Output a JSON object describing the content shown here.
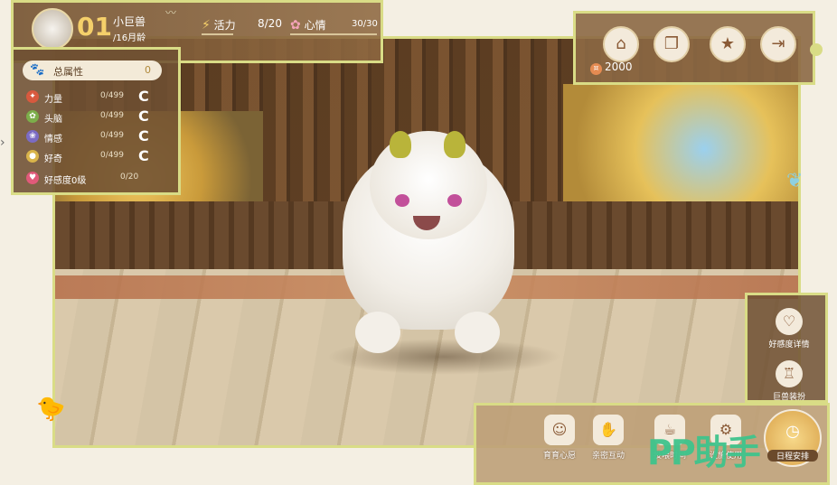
{
  "profile": {
    "number": "01",
    "name": "小巨兽",
    "age": "/16月龄",
    "energy_label": "活力",
    "energy_value": "8/20",
    "mood_label": "心情",
    "mood_value": "30/30"
  },
  "stats": {
    "total_label": "总属性",
    "total_value": "0",
    "attributes": [
      {
        "name": "力量",
        "value": "0/499",
        "grade": "C",
        "color": "#d8593e"
      },
      {
        "name": "头脑",
        "value": "0/499",
        "grade": "C",
        "color": "#7cae4a"
      },
      {
        "name": "情感",
        "value": "0/499",
        "grade": "C",
        "color": "#7b6bc4"
      },
      {
        "name": "好奇",
        "value": "0/499",
        "grade": "C",
        "color": "#d9b44a"
      }
    ],
    "affection_label": "好感度0级",
    "affection_value": "0/20"
  },
  "menu": {
    "currency_value": "2000",
    "icons": [
      "shop-icon",
      "book-icon",
      "star-icon",
      "exit-icon"
    ]
  },
  "side": {
    "affection_detail_label": "好感度详情",
    "dress_label": "巨兽装扮"
  },
  "bottom": {
    "items": [
      {
        "label": "育育心愿",
        "icon": "wish-icon"
      },
      {
        "label": "亲密互动",
        "icon": "hand-icon"
      },
      {
        "label": "投喂时间",
        "icon": "feed-icon"
      },
      {
        "label": "设施使用",
        "icon": "facility-icon"
      }
    ],
    "schedule_label": "日程安排"
  },
  "watermark": "PP助手",
  "colors": {
    "frame": "#d9dc86",
    "panel_brown": "#8c6844",
    "accent_gold": "#f5d06a"
  }
}
